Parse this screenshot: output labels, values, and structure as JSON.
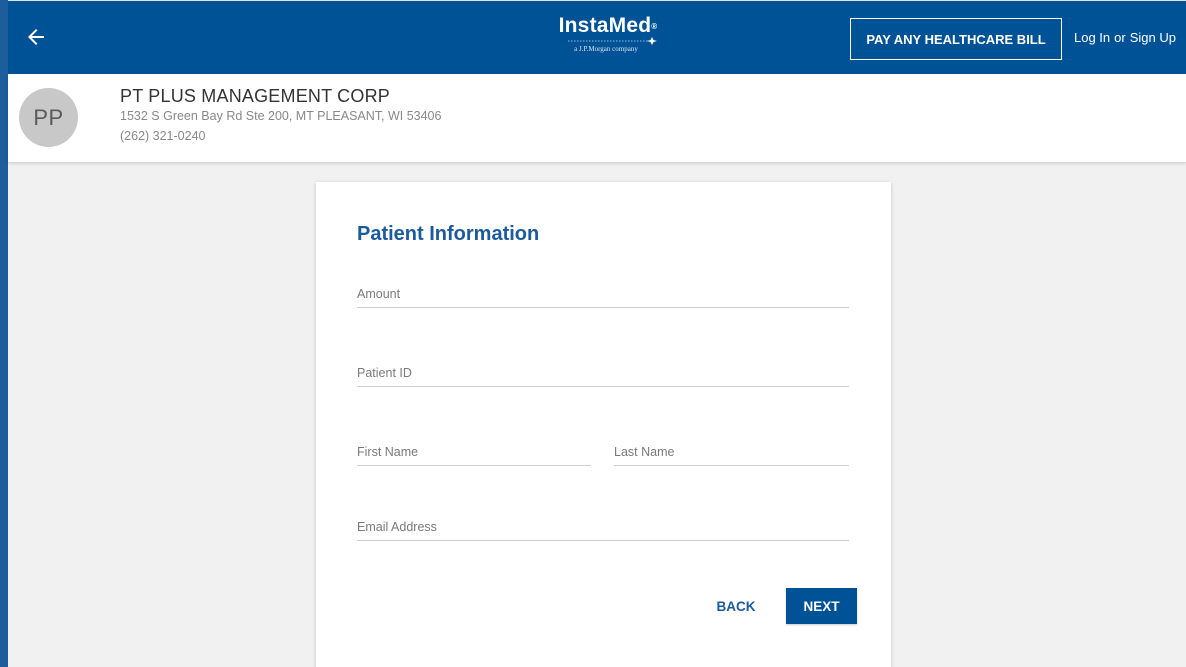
{
  "header": {
    "back_icon": "arrow-left-icon",
    "logo_text": "InstaMed",
    "logo_registered": "®",
    "logo_subtitle": "a J.P.Morgan company",
    "pay_button_label": "PAY ANY HEALTHCARE BILL",
    "login_label": "Log In",
    "or_label": "or",
    "signup_label": "Sign Up"
  },
  "merchant": {
    "initials": "PP",
    "name": "PT PLUS MANAGEMENT CORP",
    "address": "1532 S Green Bay Rd Ste 200, MT PLEASANT, WI 53406",
    "phone": "(262) 321-0240"
  },
  "form": {
    "title": "Patient Information",
    "amount": {
      "placeholder": "Amount",
      "value": ""
    },
    "patient_id": {
      "placeholder": "Patient ID",
      "value": ""
    },
    "first_name": {
      "placeholder": "First Name",
      "value": ""
    },
    "last_name": {
      "placeholder": "Last Name",
      "value": ""
    },
    "email": {
      "placeholder": "Email Address",
      "value": ""
    },
    "back_label": "BACK",
    "next_label": "NEXT"
  },
  "colors": {
    "brand_blue": "#005296",
    "title_blue": "#1b5a9c",
    "page_bg": "#f1f1f1"
  }
}
